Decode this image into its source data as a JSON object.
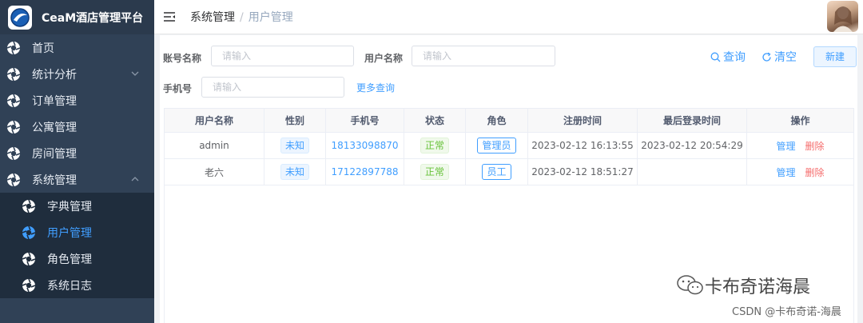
{
  "app": {
    "title": "CeaM酒店管理平台"
  },
  "sidebar": {
    "items": [
      {
        "label": "首页"
      },
      {
        "label": "统计分析"
      },
      {
        "label": "订单管理"
      },
      {
        "label": "公寓管理"
      },
      {
        "label": "房间管理"
      },
      {
        "label": "系统管理"
      }
    ],
    "submenu": [
      {
        "label": "字典管理"
      },
      {
        "label": "用户管理"
      },
      {
        "label": "角色管理"
      },
      {
        "label": "系统日志"
      }
    ]
  },
  "breadcrumb": {
    "parent": "系统管理",
    "separator": "/",
    "current": "用户管理"
  },
  "search": {
    "account_label": "账号名称",
    "account_placeholder": "请输入",
    "username_label": "用户名称",
    "username_placeholder": "请输入",
    "phone_label": "手机号",
    "phone_placeholder": "请输入",
    "more_label": "更多查询",
    "query_label": "查询",
    "clear_label": "清空",
    "new_label": "新建"
  },
  "table": {
    "headers": [
      "用户名称",
      "性别",
      "手机号",
      "状态",
      "角色",
      "注册时间",
      "最后登录时间",
      "操作"
    ],
    "rows": [
      {
        "name": "admin",
        "gender": "未知",
        "phone": "18133098870",
        "status": "正常",
        "role": "管理员",
        "registered": "2023-02-12 16:13:55",
        "last_login": "2023-02-12 20:54:29",
        "manage": "管理",
        "delete": "删除"
      },
      {
        "name": "老六",
        "gender": "未知",
        "phone": "17122897788",
        "status": "正常",
        "role": "员工",
        "registered": "2023-02-12 18:51:27",
        "last_login": "",
        "manage": "管理",
        "delete": "删除"
      }
    ]
  },
  "watermark": {
    "text": "卡布奇诺海晨",
    "csdn": "CSDN @卡布奇诺-海晨"
  },
  "colors": {
    "sidebar": "#304156",
    "submenu": "#1f2d3d",
    "accent": "#409eff",
    "danger": "#f56c6c",
    "success": "#67c23a"
  }
}
